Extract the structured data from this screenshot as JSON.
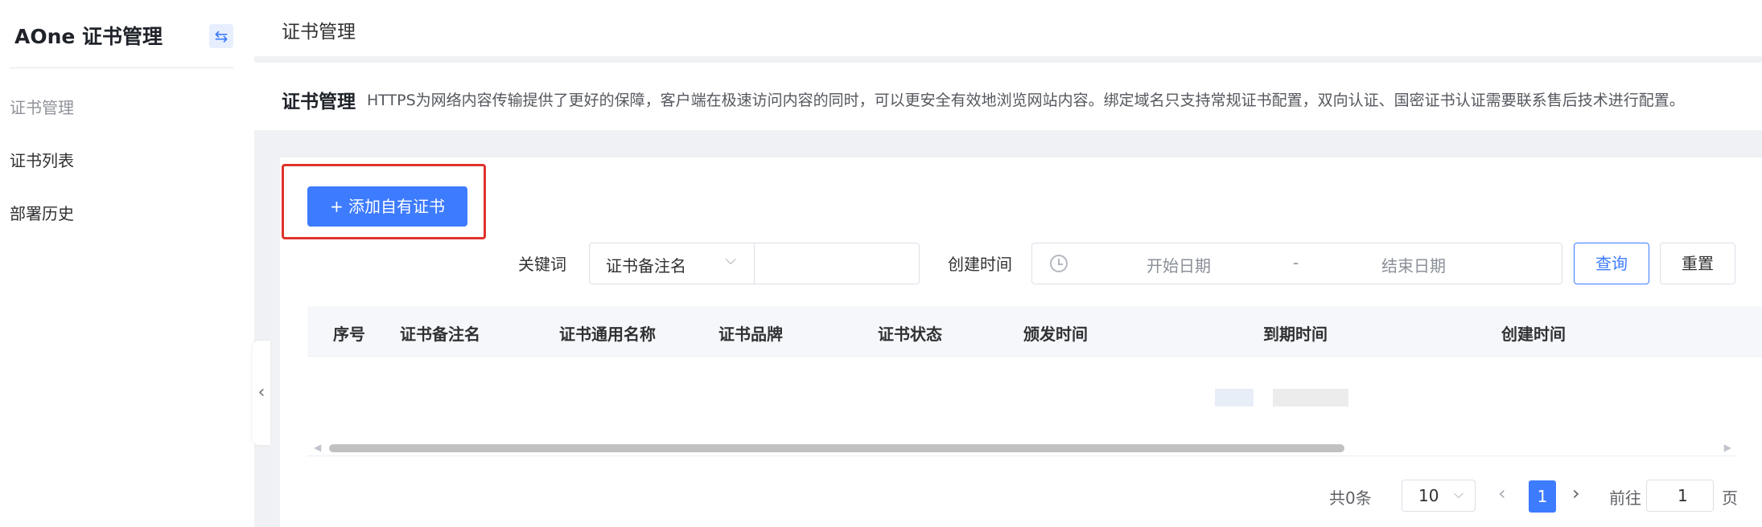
{
  "sidebar": {
    "brand": "AOne 证书管理",
    "collapse_icon": "arrows-exchange-icon",
    "group_label": "证书管理",
    "items": [
      {
        "label": "证书列表"
      },
      {
        "label": "部署历史"
      }
    ]
  },
  "header": {
    "title": "证书管理"
  },
  "description": {
    "title": "证书管理",
    "text": "HTTPS为网络内容传输提供了更好的保障，客户端在极速访问内容的同时，可以更安全有效地浏览网站内容。绑定域名只支持常规证书配置，双向认证、国密证书认证需要联系售后技术进行配置。"
  },
  "toolbar": {
    "add_label": "+ 添加自有证书"
  },
  "filters": {
    "keyword_label": "关键词",
    "keyword_select_value": "证书备注名",
    "keyword_value": "",
    "time_label": "创建时间",
    "date_start_placeholder": "开始日期",
    "date_separator": "-",
    "date_end_placeholder": "结束日期",
    "query_label": "查询",
    "reset_label": "重置"
  },
  "table": {
    "columns": [
      "序号",
      "证书备注名",
      "证书通用名称",
      "证书品牌",
      "证书状态",
      "颁发时间",
      "到期时间",
      "创建时间"
    ],
    "rows": []
  },
  "pagination": {
    "total_text": "共0条",
    "page_size": "10",
    "current_page": "1",
    "goto_label": "前往",
    "goto_value": "1",
    "goto_suffix": "页"
  },
  "colors": {
    "accent": "#3d7bff",
    "highlight": "#e0322c"
  }
}
